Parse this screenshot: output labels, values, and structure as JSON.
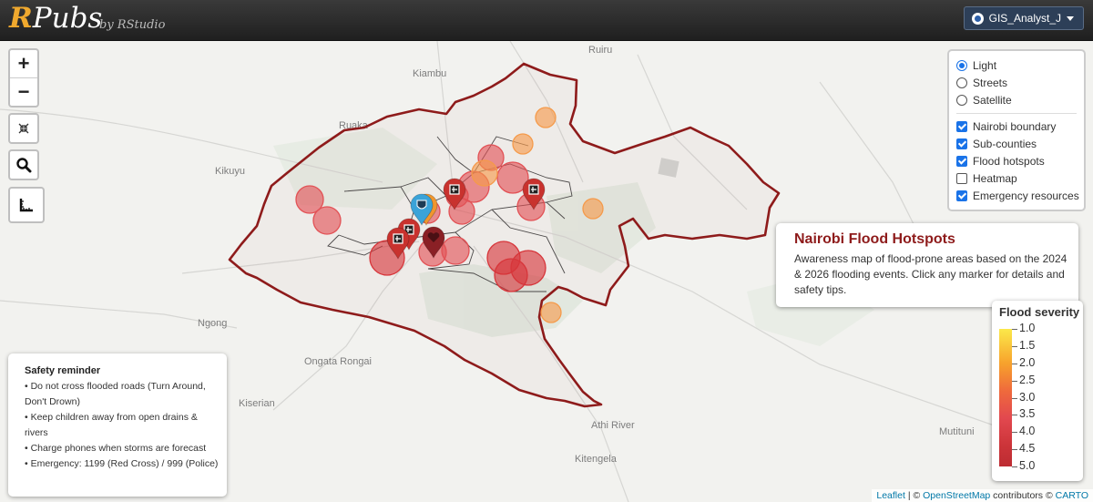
{
  "header": {
    "logo_r": "R",
    "logo_rest": "Pubs",
    "byline": "by RStudio",
    "user": "GIS_Analyst_J"
  },
  "map_controls": {
    "zoom_in": "+",
    "zoom_out": "−"
  },
  "layers": {
    "basemaps": [
      {
        "label": "Light",
        "selected": true
      },
      {
        "label": "Streets",
        "selected": false
      },
      {
        "label": "Satellite",
        "selected": false
      }
    ],
    "overlays": [
      {
        "label": "Nairobi boundary",
        "checked": true
      },
      {
        "label": "Sub-counties",
        "checked": true
      },
      {
        "label": "Flood hotspots",
        "checked": true
      },
      {
        "label": "Heatmap",
        "checked": false
      },
      {
        "label": "Emergency resources",
        "checked": true
      }
    ]
  },
  "info": {
    "title": "Nairobi Flood Hotspots",
    "text": "Awareness map of flood-prone areas based on the 2024 & 2026 flooding events. Click any marker for details and safety tips."
  },
  "legend": {
    "title": "Flood severity",
    "ticks": [
      "1.0",
      "1.5",
      "2.0",
      "2.5",
      "3.0",
      "3.5",
      "4.0",
      "4.5",
      "5.0"
    ]
  },
  "safety": {
    "title": "Safety reminder",
    "items": [
      "• Do not cross flooded roads (Turn Around, Don't Drown)",
      "• Keep children away from open drains & rivers",
      "• Charge phones when storms are forecast",
      "• Emergency: 1199 (Red Cross) / 999 (Police)"
    ]
  },
  "places": [
    {
      "name": "Ruiru"
    },
    {
      "name": "Kiambu"
    },
    {
      "name": "Ruaka"
    },
    {
      "name": "Kikuyu"
    },
    {
      "name": "Ngong"
    },
    {
      "name": "Ongata Rongai"
    },
    {
      "name": "Kiserian"
    },
    {
      "name": "Athi River"
    },
    {
      "name": "Kitengela"
    },
    {
      "name": "Mutituni"
    }
  ],
  "attribution": {
    "leaflet": "Leaflet",
    "sep1": " | © ",
    "osm": "OpenStreetMap",
    "mid": " contributors © ",
    "carto": "CARTO"
  },
  "colors": {
    "boundary": "#8e1b1b",
    "hotspot_high": "#d7353a",
    "hotspot_mid": "#e25155",
    "hotspot_low": "#f59a4a",
    "title_red": "#8e1b1b"
  }
}
